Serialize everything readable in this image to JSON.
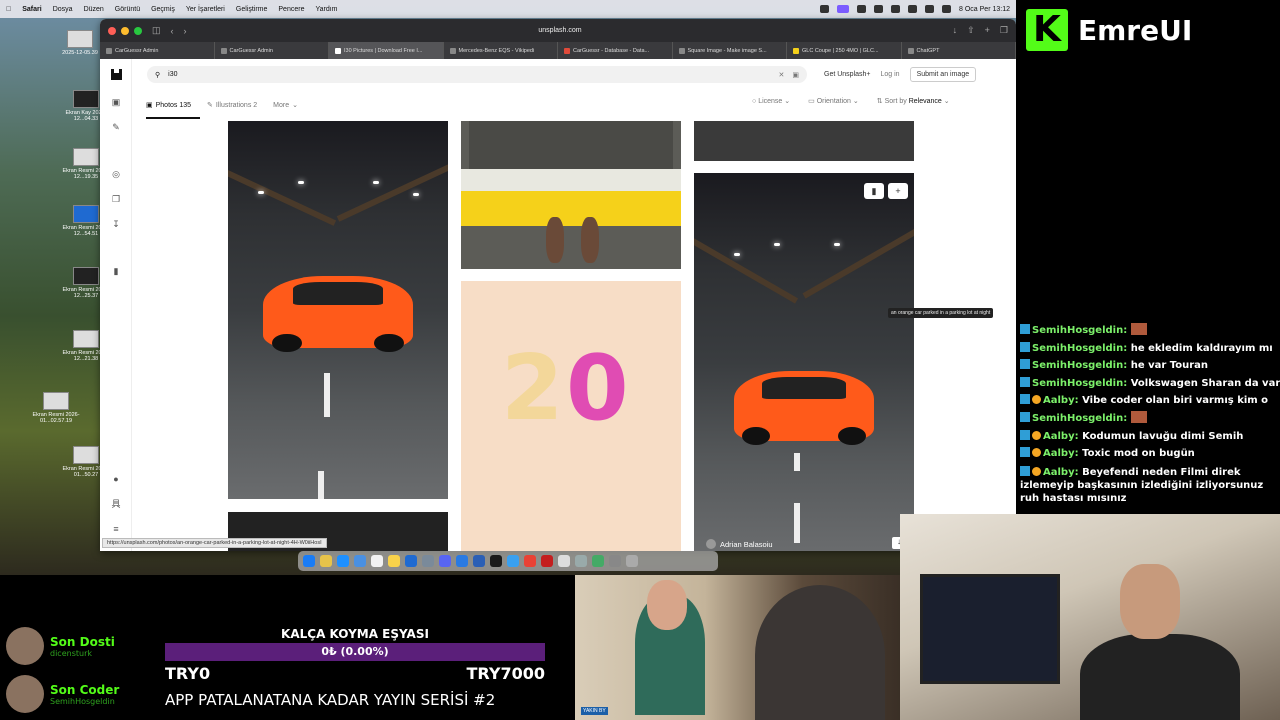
{
  "menubar": {
    "apple": "",
    "items": [
      "Safari",
      "Dosya",
      "Düzen",
      "Görüntü",
      "Geçmiş",
      "Yer İşaretleri",
      "Geliştirme",
      "Pencere",
      "Yardım"
    ],
    "clock": "8 Oca Per  13:12"
  },
  "desktop_icons": [
    {
      "label": "2025-12-05.39"
    },
    {
      "label": "Ekran Kay 2025-12...04.33"
    },
    {
      "label": "Ekran Resmi 2025-12...19.35"
    },
    {
      "label": "Ekran Resmi 2025-12...54.51"
    },
    {
      "label": "Ekran Resmi 2025-12...25.37"
    },
    {
      "label": "Ekran Resmi 2025-12...21.38"
    },
    {
      "label": "Ekran Resmi 2026-01...02.57.19"
    },
    {
      "label": "Ekran Resmi 2026-01...50.27"
    }
  ],
  "browser": {
    "url": "unsplash.com",
    "tabs": [
      {
        "label": "CarGuessr Admin"
      },
      {
        "label": "CarGuessr Admin"
      },
      {
        "label": "I30 Pictures | Download Free I...",
        "active": true
      },
      {
        "label": "Mercedes-Benz EQS - Vikipedi"
      },
      {
        "label": "CarGuessr - Database - Data..."
      },
      {
        "label": "Square Image - Make image S..."
      },
      {
        "label": "GLC Coupe | 250 4MO | GLC..."
      },
      {
        "label": "ChatGPT"
      }
    ]
  },
  "unsplash": {
    "search_value": "i30",
    "get_plus": "Get Unsplash+",
    "login": "Log in",
    "submit": "Submit an image",
    "tab_photos": "Photos 135",
    "tab_illustrations": "Illustrations 2",
    "tab_more": "More",
    "license": "License",
    "orientation": "Orientation",
    "sort_prefix": "Sort by",
    "sort_value": "Relevance",
    "photo_author": "Adrian Balasoiu",
    "tooltip": "an orange car parked in a parking lot at night",
    "status_url": "https://unsplash.com/photos/an-orange-car-parked-in-a-parking-lot-at-night-4H-W0iiHosI"
  },
  "brand": {
    "name": "EmreUI"
  },
  "chat": [
    {
      "user": "SemihHosgeldin:",
      "text": "",
      "emote": true,
      "badges": [
        "b"
      ]
    },
    {
      "user": "SemihHosgeldin:",
      "text": "he ekledim kaldırayım mı",
      "badges": [
        "b"
      ]
    },
    {
      "user": "SemihHosgeldin:",
      "text": "he var Touran",
      "badges": [
        "b"
      ]
    },
    {
      "user": "SemihHosgeldin:",
      "text": "Volkswagen Sharan da var",
      "badges": [
        "b"
      ]
    },
    {
      "user": "Aalby:",
      "text": "Vibe coder olan biri varmış kim o",
      "badges": [
        "b",
        "o"
      ]
    },
    {
      "user": "SemihHosgeldin:",
      "text": "",
      "emote": true,
      "badges": [
        "b"
      ]
    },
    {
      "user": "Aalby:",
      "text": "Kodumun lavuğu dimi Semih",
      "badges": [
        "b",
        "o"
      ]
    },
    {
      "user": "Aalby:",
      "text": "Toxic mod on bugün",
      "badges": [
        "b",
        "o"
      ]
    },
    {
      "user": "Aalby:",
      "text": "Beyefendi neden Filmi direk izlemeyip başkasının izlediğini izliyorsunuz ruh hastası mısınız",
      "badges": [
        "b",
        "o"
      ]
    }
  ],
  "overlay": {
    "last_follower_title": "Son Dosti",
    "last_follower_name": "dicensturk",
    "last_coder_title": "Son Coder",
    "last_coder_name": "SemihHosgeldin",
    "goal_title": "KALÇA KOYMA EŞYASI",
    "goal_progress": "0₺ (0.00%)",
    "goal_progress_fraction": 0.0,
    "goal_start": "TRY0",
    "goal_end": "TRY7000",
    "series_title": "APP PATALANATANA KADAR YAYIN SERİSİ #2"
  },
  "tv_logo": "YAKIN BY"
}
